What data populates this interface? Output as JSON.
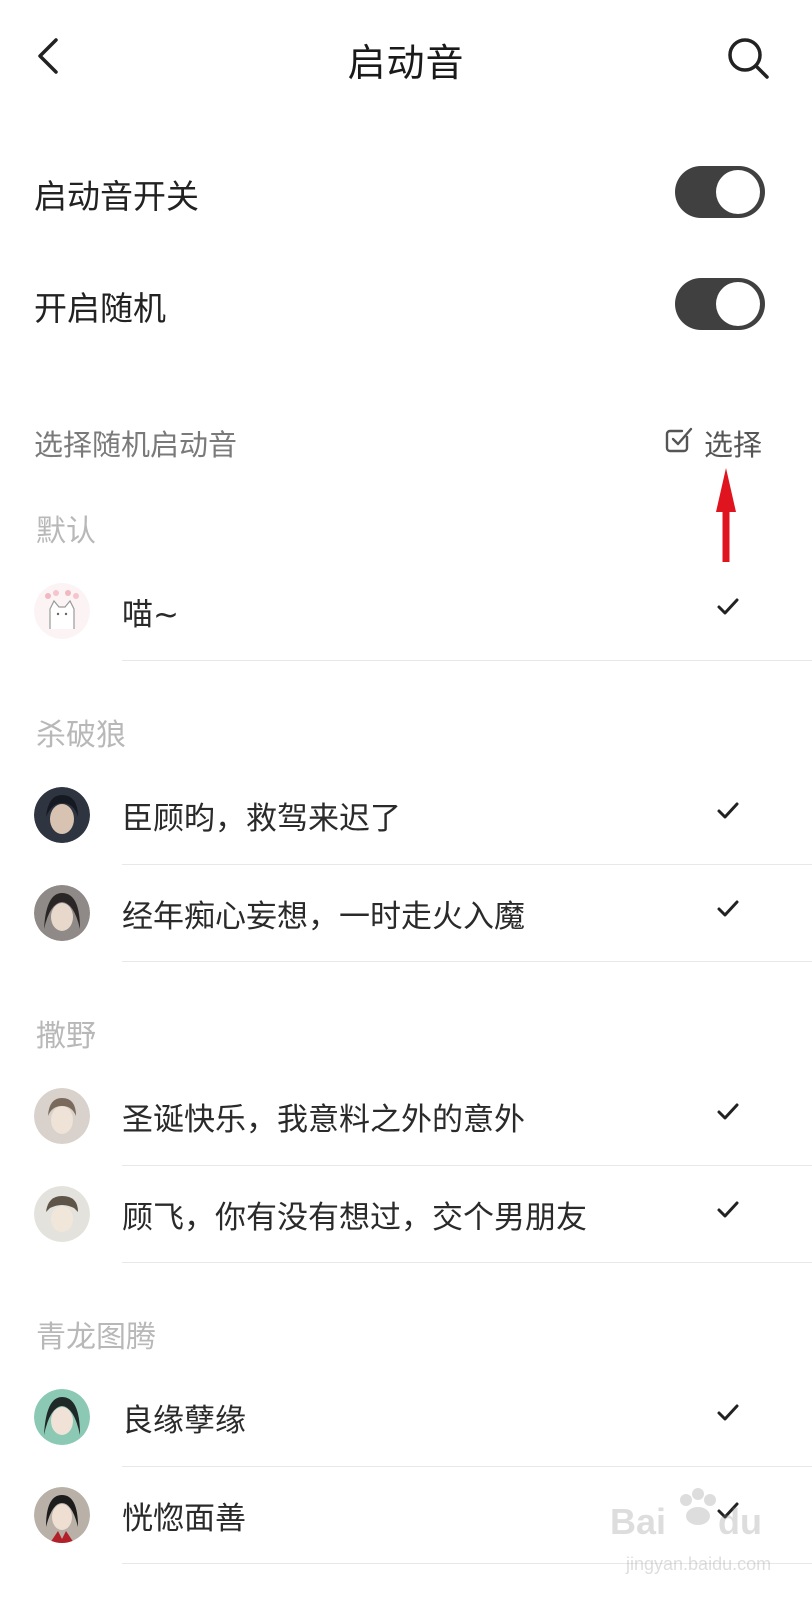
{
  "header": {
    "title": "启动音",
    "back_icon": "chevron-left-icon",
    "search_icon": "search-icon"
  },
  "settings": [
    {
      "label": "启动音开关",
      "on": true
    },
    {
      "label": "开启随机",
      "on": true
    }
  ],
  "random_select": {
    "caption": "选择随机启动音",
    "button_label": "选择",
    "button_icon": "checkbox-icon"
  },
  "groups": [
    {
      "title": "默认",
      "items": [
        {
          "label": "喵~",
          "checked": true
        }
      ]
    },
    {
      "title": "杀破狼",
      "items": [
        {
          "label": "臣顾昀，救驾来迟了",
          "checked": true
        },
        {
          "label": "经年痴心妄想，一时走火入魔",
          "checked": true
        }
      ]
    },
    {
      "title": "撒野",
      "items": [
        {
          "label": "圣诞快乐，我意料之外的意外",
          "checked": true
        },
        {
          "label": "顾飞，你有没有想过，交个男朋友",
          "checked": true
        }
      ]
    },
    {
      "title": "青龙图腾",
      "items": [
        {
          "label": "良缘孽缘",
          "checked": true
        },
        {
          "label": "恍惚面善",
          "checked": true
        }
      ]
    }
  ],
  "watermark": {
    "text": "Baidu经验",
    "subtext": "jingyan.baidu.com"
  },
  "colors": {
    "toggle_on": "#404040",
    "annotation_arrow": "#e0141e",
    "group_header": "#b8b8b8"
  }
}
